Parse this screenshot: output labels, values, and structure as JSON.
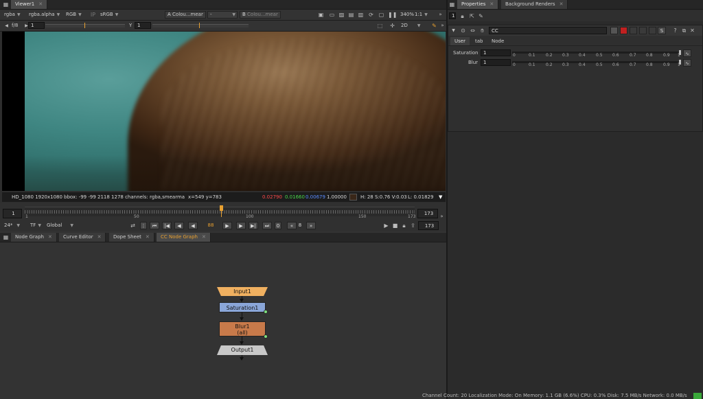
{
  "viewer": {
    "tab": "Viewer1",
    "toolbar1": {
      "channels": "rgba",
      "alpha": "rgba.alpha",
      "colorspace": "RGB",
      "lut": "sRGB",
      "a_label": "A",
      "a_value": "Colou...mear",
      "mid": "-",
      "b_label": "B",
      "b_value": "Colou...mear",
      "zoom": "340%",
      "ratio": "1:1"
    },
    "toolbar2": {
      "fstop": "f/8",
      "frame_value": "1",
      "y_label": "Y",
      "y_value": "1",
      "view_mode": "2D"
    },
    "info": {
      "format": "HD_1080 1920x1080",
      "bbox": "bbox: -99 -99 2118 1278 channels: rgba,smearma",
      "coords": "x=549 y=783",
      "r": "0.02790",
      "g": "0.01660",
      "b": "0.00679",
      "a": "1.00000",
      "hsv": "H: 28 S:0.76 V:0.03",
      "lum": "L: 0.01829"
    },
    "timeline": {
      "start": "1",
      "end": "173",
      "end_field": "173",
      "ticks": [
        "1",
        "50",
        "100",
        "150",
        "173"
      ],
      "fps": "24*",
      "tf": "TF",
      "global": "Global",
      "current_frame": "88",
      "increment": "8",
      "out_field": "173"
    }
  },
  "bottom_tabs": [
    {
      "label": "Node Graph"
    },
    {
      "label": "Curve Editor"
    },
    {
      "label": "Dope Sheet"
    },
    {
      "label": "CC Node Graph"
    }
  ],
  "graph": {
    "nodes": [
      {
        "label": "Input1"
      },
      {
        "label": "Saturation1"
      },
      {
        "label": "Blur1"
      },
      {
        "label": "(all)"
      },
      {
        "label": "Output1"
      }
    ]
  },
  "properties": {
    "tabs": [
      {
        "label": "Properties"
      },
      {
        "label": "Background Renders"
      }
    ],
    "max_panels": "1",
    "node_name": "CC",
    "subtabs": [
      "User",
      "tab",
      "Node"
    ],
    "knobs": [
      {
        "label": "Saturation",
        "value": "1"
      },
      {
        "label": "Blur",
        "value": "1"
      }
    ],
    "slider_ticks": [
      "0",
      "0.1",
      "0.2",
      "0.3",
      "0.4",
      "0.5",
      "0.6",
      "0.7",
      "0.8",
      "0.9",
      "1"
    ]
  },
  "status": {
    "text": "Channel Count: 20  Localization Mode: On  Memory: 1.1 GB (6.6%)  CPU: 0.3%  Disk: 7.5 MB/s  Network: 0.0 MB/s"
  },
  "colors": {
    "input_node": "#f0b060",
    "saturation_node": "#8aa6d8",
    "blur_node": "#c87a4a",
    "output_node": "#c8c8c8",
    "accent_orange": "#e8a030"
  }
}
